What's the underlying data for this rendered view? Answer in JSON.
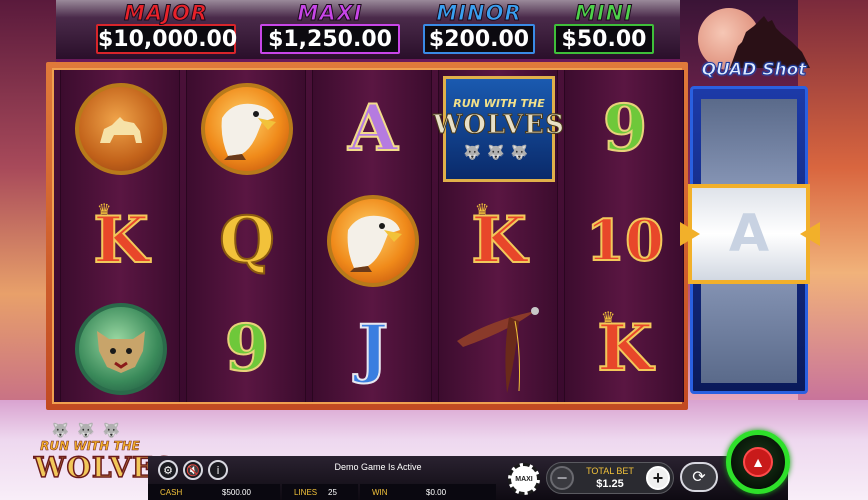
{
  "jackpots": {
    "major": {
      "title": "MAJOR",
      "value": "$10,000.00"
    },
    "maxi": {
      "title": "MAXI",
      "value": "$1,250.00"
    },
    "minor": {
      "title": "MINOR",
      "value": "$200.00"
    },
    "mini": {
      "title": "MINI",
      "value": "$50.00"
    }
  },
  "side_logo": "QUAD Shot",
  "reels": [
    [
      "coin-medallion",
      "K",
      "lynx-medallion"
    ],
    [
      "eagle-medallion",
      "Q",
      "9"
    ],
    [
      "A",
      "eagle-medallion",
      "J"
    ],
    [
      "wild-run-with-the-wolves",
      "K",
      "feathers"
    ],
    [
      "9",
      "10",
      "K"
    ]
  ],
  "wild_symbol": {
    "small": "RUN WITH THE",
    "big": "WOLVES"
  },
  "card_labels": {
    "a": "A",
    "k": "K",
    "q": "Q",
    "nine": "9",
    "ten": "10",
    "j": "J"
  },
  "side_reel_symbol": "A",
  "bottom_logo": {
    "small": "RUN WITH THE",
    "big": "WOLVES"
  },
  "status": "Demo Game Is Active",
  "info": {
    "cash_label": "CASH",
    "cash_value": "$500.00",
    "lines_label": "LINES",
    "lines_value": "25",
    "win_label": "WIN",
    "win_value": "$0.00"
  },
  "bet": {
    "label": "TOTAL BET",
    "value": "$1.25",
    "chip": "MAXI"
  },
  "icons": {
    "settings": "gear-icon",
    "sound": "sound-muted-icon",
    "info": "info-icon",
    "autoplay": "autoplay-icon",
    "spin": "spin-icon"
  }
}
